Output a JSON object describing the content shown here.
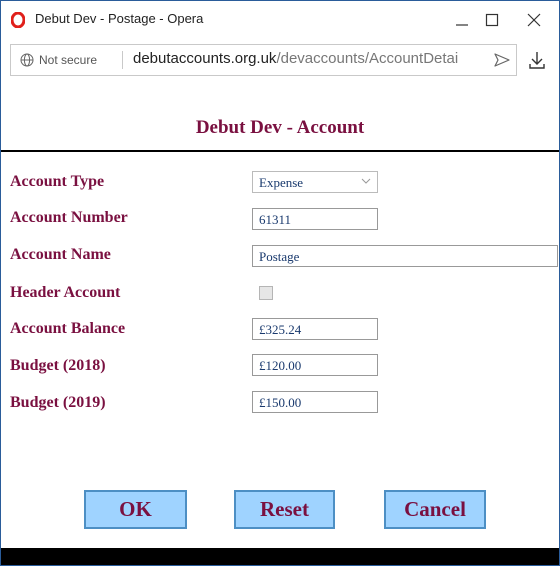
{
  "window": {
    "title": "Debut Dev - Postage - Opera",
    "controls": {
      "minimize": "minimize-icon",
      "maximize": "maximize-icon",
      "close": "close-icon"
    }
  },
  "addressbar": {
    "security_label": "Not secure",
    "url_host": "debutaccounts.org.uk",
    "url_path": "/devaccounts/AccountDetai",
    "icons": [
      "globe-icon",
      "send-icon",
      "download-icon"
    ]
  },
  "page": {
    "heading": "Debut Dev - Account",
    "fields": {
      "account_type": {
        "label": "Account Type",
        "value": "Expense"
      },
      "account_number": {
        "label": "Account Number",
        "value": "61311"
      },
      "account_name": {
        "label": "Account Name",
        "value": "Postage"
      },
      "header_account": {
        "label": "Header Account",
        "checked": false
      },
      "account_balance": {
        "label": "Account Balance",
        "value": "£325.24"
      },
      "budget_2018": {
        "label": "Budget (2018)",
        "value": "£120.00"
      },
      "budget_2019": {
        "label": "Budget (2019)",
        "value": "£150.00"
      }
    },
    "buttons": {
      "ok": "OK",
      "reset": "Reset",
      "cancel": "Cancel"
    }
  },
  "colors": {
    "label_text": "#7a1040",
    "value_text": "#1a3a6e",
    "button_bg": "#9fd3ff",
    "button_border": "#4d8fc4",
    "opera_red": "#e0201b"
  }
}
